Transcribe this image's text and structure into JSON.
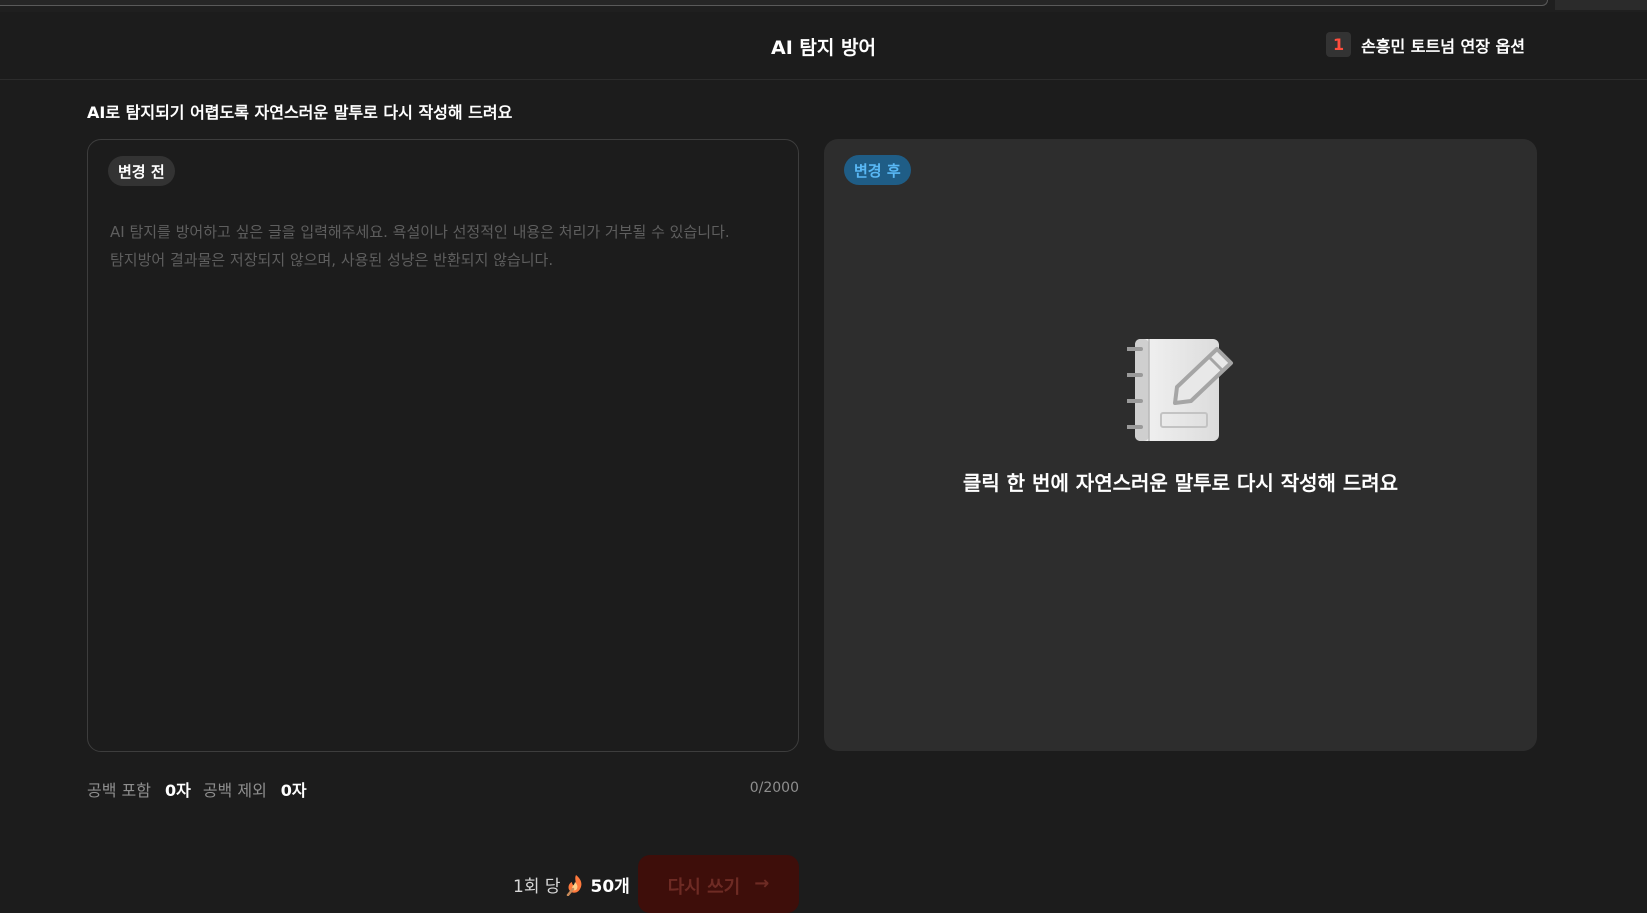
{
  "header": {
    "title": "AI 탐지 방어",
    "notice_badge": "1",
    "notice_text": "손흥민 토트넘 연장 옵션"
  },
  "subtitle": "AI로 탐지되기 어렵도록 자연스러운 말투로 다시 작성해 드려요",
  "before_panel": {
    "label": "변경 전",
    "placeholder": "AI 탐지를 방어하고 싶은 글을 입력해주세요. 욕설이나 선정적인 내용은 처리가 거부될 수 있습니다.\n탐지방어 결과물은 저장되지 않으며, 사용된 성냥은 반환되지 않습니다.",
    "value": ""
  },
  "after_panel": {
    "label": "변경 후",
    "empty_icon": "notebook-pencil-icon",
    "empty_message": "클릭 한 번에 자연스러운 말투로 다시 작성해 드려요"
  },
  "counts": {
    "with_spaces_label": "공백 포함",
    "with_spaces_value": "0자",
    "without_spaces_label": "공백 제외",
    "without_spaces_value": "0자",
    "limit": "0/2000"
  },
  "cost": {
    "per_label": "1회 당",
    "icon": "match-icon",
    "amount": "50개"
  },
  "rewrite_button": {
    "label": "다시 쓰기",
    "arrow": "→"
  },
  "colors": {
    "background": "#1c1c1c",
    "panel_after_bg": "#2d2d2d",
    "after_pill_bg": "#1f5d86",
    "after_pill_text": "#59b8f5",
    "notice_badge_text": "#ff4d3d",
    "button_bg": "#3e0e0a",
    "button_text": "#6e2b24"
  }
}
